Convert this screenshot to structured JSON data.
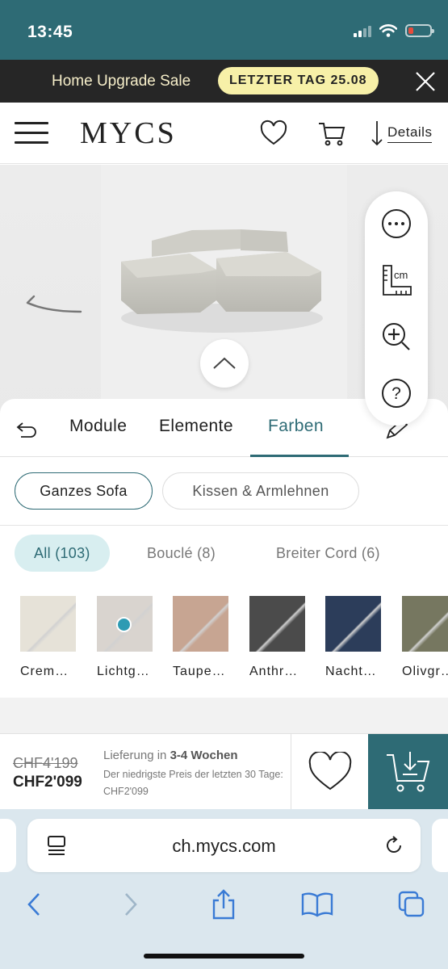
{
  "status_bar": {
    "time": "13:45"
  },
  "promo": {
    "text": "Home Upgrade Sale",
    "badge": "LETZTER TAG 25.08"
  },
  "header": {
    "logo": "MYCS",
    "details_label": "Details"
  },
  "tabs": [
    {
      "label": "Module"
    },
    {
      "label": "Elemente"
    },
    {
      "label": "Farben"
    }
  ],
  "scope_chips": [
    {
      "label": "Ganzes Sofa"
    },
    {
      "label": "Kissen & Armlehnen"
    }
  ],
  "material_filters": [
    {
      "label": "All (103)"
    },
    {
      "label": "Bouclé (8)"
    },
    {
      "label": "Breiter Cord (6)"
    }
  ],
  "swatches": [
    {
      "label": "Crem…",
      "color": "#e6e2d8"
    },
    {
      "label": "Lichtg…",
      "color": "#d9d4cf"
    },
    {
      "label": "Taupe…",
      "color": "#c7a592"
    },
    {
      "label": "Anthr…",
      "color": "#4b4b4b"
    },
    {
      "label": "Nacht…",
      "color": "#2c3d5a"
    },
    {
      "label": "Olivgr…",
      "color": "#767760"
    }
  ],
  "price": {
    "old": "CHF4'199",
    "new": "CHF2'099",
    "delivery_prefix": "Lieferung in",
    "delivery_time": "3-4 Wochen",
    "lowest_note": "Der niedrigste Preis der letzten 30 Tage: CHF2'099"
  },
  "browser": {
    "url": "ch.mycs.com"
  },
  "colors": {
    "brand_teal": "#2e6b75",
    "promo_badge": "#f7f0a8",
    "filter_active_bg": "#d8eef0"
  }
}
